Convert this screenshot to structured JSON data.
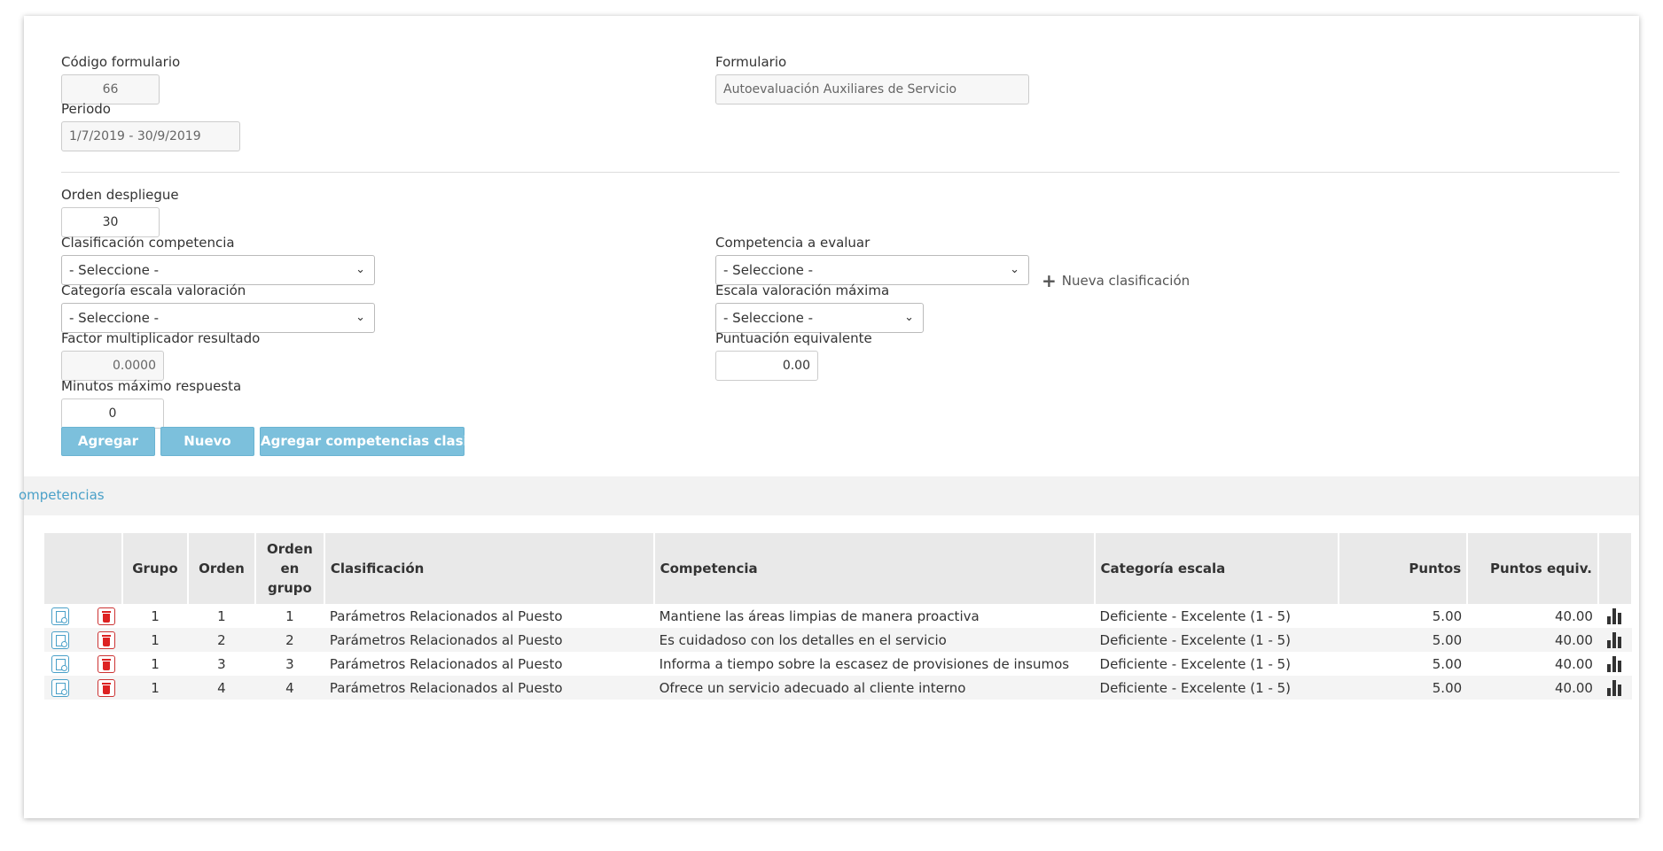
{
  "form": {
    "codigo_label": "Código formulario",
    "codigo_value": "66",
    "formulario_label": "Formulario",
    "formulario_value": "Autoevaluación Auxiliares de Servicio",
    "periodo_label": "Periodo",
    "periodo_value": "1/7/2019 - 30/9/2019",
    "orden_label": "Orden despliegue",
    "orden_value": "30",
    "clasificacion_label": "Clasificación competencia",
    "clasificacion_value": "- Seleccione -",
    "competencia_label": "Competencia a evaluar",
    "competencia_value": "- Seleccione -",
    "nueva_clasificacion": "Nueva clasificación",
    "categoria_label": "Categoría escala valoración",
    "categoria_value": "- Seleccione -",
    "escala_label": "Escala valoración máxima",
    "escala_value": "- Seleccione -",
    "factor_label": "Factor multiplicador resultado",
    "factor_value": "0.0000",
    "puntuacion_label": "Puntuación equivalente",
    "puntuacion_value": "0.00",
    "minutos_label": "Minutos máximo respuesta",
    "minutos_value": "0"
  },
  "buttons": {
    "agregar": "Agregar",
    "nuevo": "Nuevo",
    "agregar_competencias": "Agregar competencias clasificación"
  },
  "section": {
    "title": "ompetencias"
  },
  "table": {
    "headers": {
      "grupo": "Grupo",
      "orden": "Orden",
      "orden_grupo_1": "Orden",
      "orden_grupo_2": "en",
      "orden_grupo_3": "grupo",
      "clasificacion": "Clasificación",
      "competencia": "Competencia",
      "categoria": "Categoría escala",
      "puntos": "Puntos",
      "puntos_equiv": "Puntos equiv."
    },
    "rows": [
      {
        "grupo": "1",
        "orden": "1",
        "orden_grupo": "1",
        "clasificacion": "Parámetros Relacionados al Puesto",
        "competencia": "Mantiene las áreas limpias de manera proactiva",
        "categoria": "Deficiente - Excelente (1 - 5)",
        "puntos": "5.00",
        "puntos_equiv": "40.00"
      },
      {
        "grupo": "1",
        "orden": "2",
        "orden_grupo": "2",
        "clasificacion": "Parámetros Relacionados al Puesto",
        "competencia": "Es cuidadoso con los detalles en el servicio",
        "categoria": "Deficiente - Excelente (1 - 5)",
        "puntos": "5.00",
        "puntos_equiv": "40.00"
      },
      {
        "grupo": "1",
        "orden": "3",
        "orden_grupo": "3",
        "clasificacion": "Parámetros Relacionados al Puesto",
        "competencia": "Informa a tiempo sobre la escasez de provisiones de insumos",
        "categoria": "Deficiente - Excelente (1 - 5)",
        "puntos": "5.00",
        "puntos_equiv": "40.00"
      },
      {
        "grupo": "1",
        "orden": "4",
        "orden_grupo": "4",
        "clasificacion": "Parámetros Relacionados al Puesto",
        "competencia": "Ofrece un servicio adecuado al cliente interno",
        "categoria": "Deficiente - Excelente (1 - 5)",
        "puntos": "5.00",
        "puntos_equiv": "40.00"
      }
    ]
  }
}
